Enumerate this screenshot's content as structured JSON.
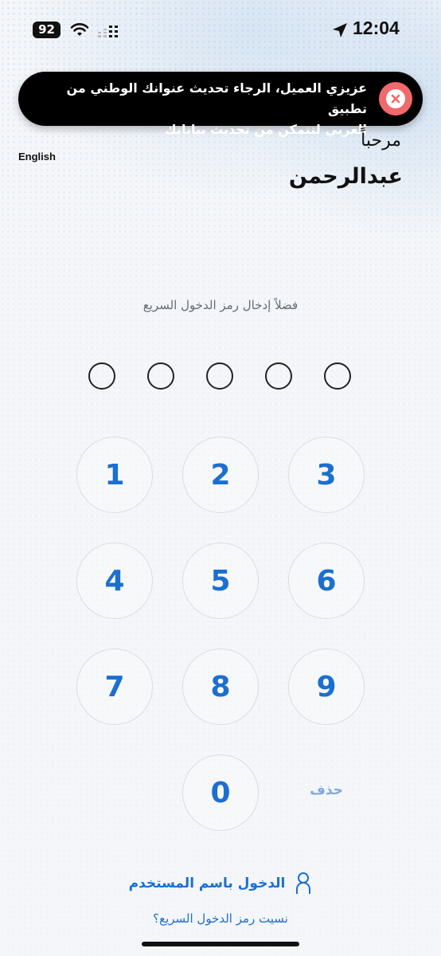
{
  "status_bar": {
    "battery": "92",
    "time": "12:04"
  },
  "toast": {
    "line1": "عزيزي العميل، الرجاء تحديث عنوانك الوطني من تطبيق",
    "line2": "العربي لتتمكن من تحديث بياناتك"
  },
  "header": {
    "welcome": "مرحباً",
    "username": "عبدالرحمن",
    "language_toggle": "English"
  },
  "pin_prompt": "فضلاً إدخال رمز الدخول السريع",
  "pin_length": 5,
  "keypad": {
    "keys": [
      "1",
      "2",
      "3",
      "4",
      "5",
      "6",
      "7",
      "8",
      "9",
      "0"
    ],
    "delete_label": "حذف"
  },
  "login_with_username": "الدخول باسم المستخدم",
  "forgot_pin": "نسيت رمز الدخول السريع؟",
  "colors": {
    "accent": "#1b6fd0",
    "toast_bg": "#000000",
    "close_red": "#f0696d"
  }
}
